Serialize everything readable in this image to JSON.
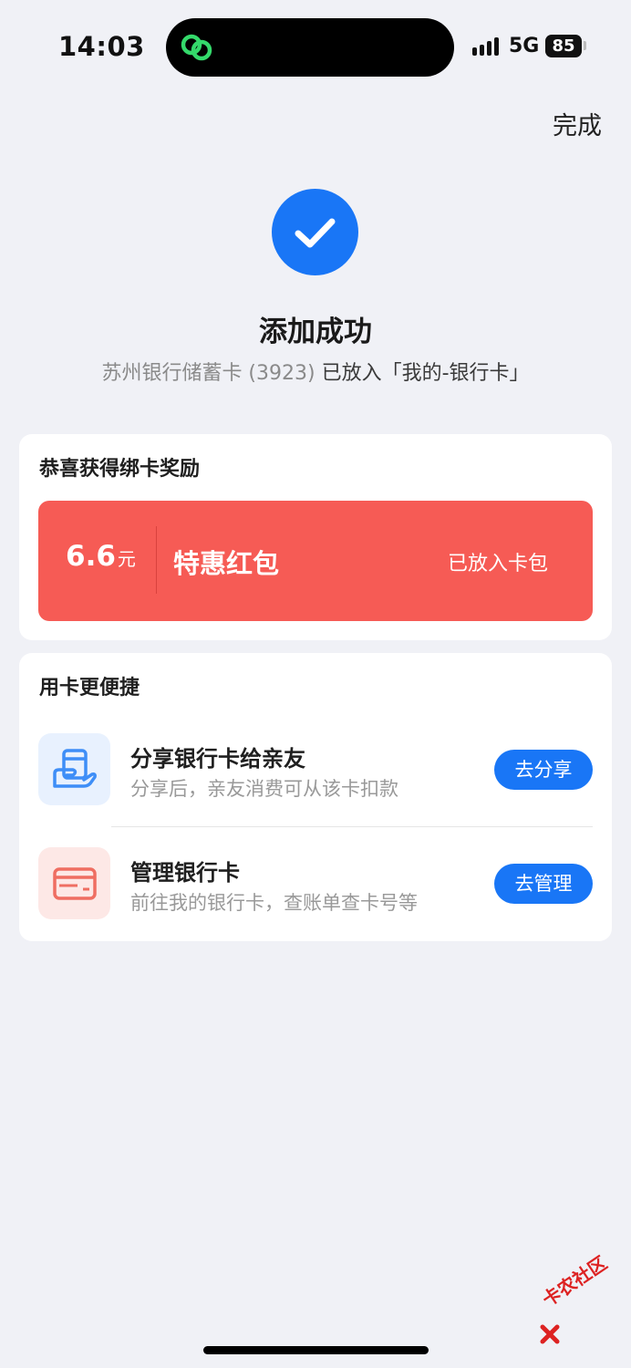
{
  "status_bar": {
    "time": "14:03",
    "network": "5G",
    "battery": "85"
  },
  "header": {
    "done_label": "完成"
  },
  "result": {
    "title": "添加成功",
    "card_name": "苏州银行储蓄卡 (3923)",
    "placed_text": "已放入「我的-银行卡」"
  },
  "reward": {
    "section_title": "恭喜获得绑卡奖励",
    "amount": "6.6",
    "unit": "元",
    "label": "特惠红包",
    "status": "已放入卡包"
  },
  "features": {
    "section_title": "用卡更便捷",
    "items": [
      {
        "title": "分享银行卡给亲友",
        "desc": "分享后，亲友消费可从该卡扣款",
        "button": "去分享",
        "icon": "hand-card-icon"
      },
      {
        "title": "管理银行卡",
        "desc": "前往我的银行卡，查账单查卡号等",
        "button": "去管理",
        "icon": "bank-card-icon"
      }
    ]
  },
  "watermark": {
    "text": "卡农社区"
  },
  "colors": {
    "accent": "#1976f6",
    "reward_red": "#f65b55"
  }
}
